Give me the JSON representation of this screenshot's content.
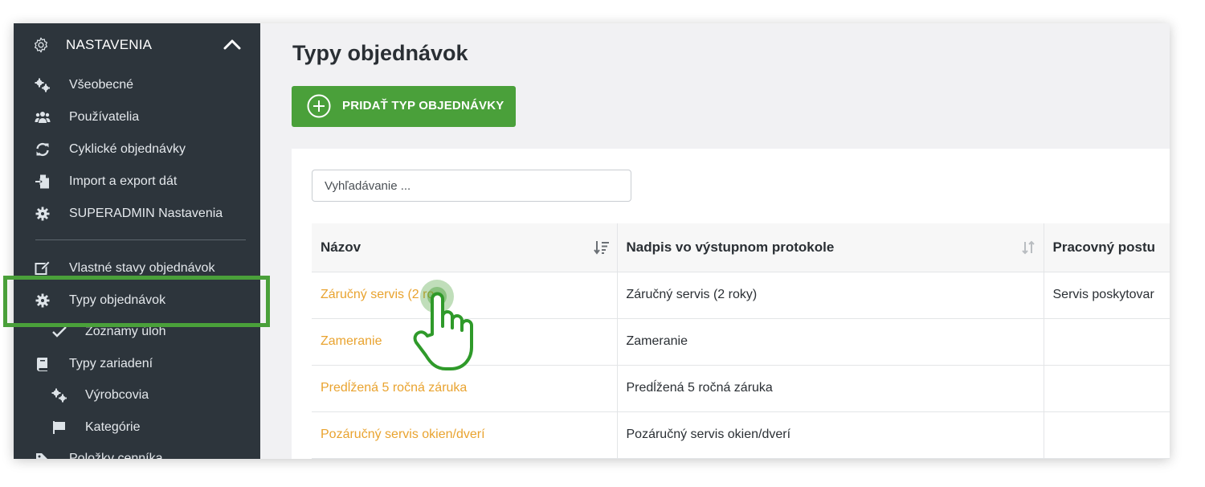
{
  "sidebar": {
    "header": {
      "title": "NASTAVENIA",
      "icon": "gear-outline-icon",
      "chevron": "chevron-up-icon"
    },
    "items": [
      {
        "label": "Všeobecné",
        "icon": "gears-icon"
      },
      {
        "label": "Používatelia",
        "icon": "users-icon"
      },
      {
        "label": "Cyklické objednávky",
        "icon": "sync-icon"
      },
      {
        "label": "Import a export dát",
        "icon": "file-import-icon"
      },
      {
        "label": "SUPERADMIN Nastavenia",
        "icon": "gear-icon"
      },
      {
        "label": "Vlastné stavy objednávok",
        "icon": "edit-icon"
      },
      {
        "label": "Typy objednávok",
        "icon": "gear-icon"
      },
      {
        "label": "Zoznamy úloh",
        "icon": "check-icon"
      },
      {
        "label": "Typy zariadení",
        "icon": "book-icon"
      },
      {
        "label": "Výrobcovia",
        "icon": "gears-icon"
      },
      {
        "label": "Kategórie",
        "icon": "flag-icon"
      },
      {
        "label": "Položky cenníka",
        "icon": "tag-icon"
      }
    ]
  },
  "main": {
    "title": "Typy objednávok",
    "add_button_label": "PRIDAŤ TYP OBJEDNÁVKY",
    "search_placeholder": "Vyhľadávanie ...",
    "table": {
      "columns": [
        "Názov",
        "Nadpis vo výstupnom protokole",
        "Pracovný postu"
      ],
      "rows": [
        [
          "Záručný servis (2 ro",
          "Záručný servis (2 roky)",
          "Servis poskytovar"
        ],
        [
          "Zameranie",
          "Zameranie",
          ""
        ],
        [
          "Predĺžená 5 ročná záruka",
          "Predĺžená 5 ročná záruka",
          ""
        ],
        [
          "Pozáručný servis okien/dverí",
          "Pozáručný servis okien/dverí",
          ""
        ]
      ]
    }
  },
  "colors": {
    "sidebar_bg": "#2d353c",
    "accent_green": "#4aa03a",
    "link_orange": "#e9a32f",
    "page_bg": "#f1f1f3"
  }
}
